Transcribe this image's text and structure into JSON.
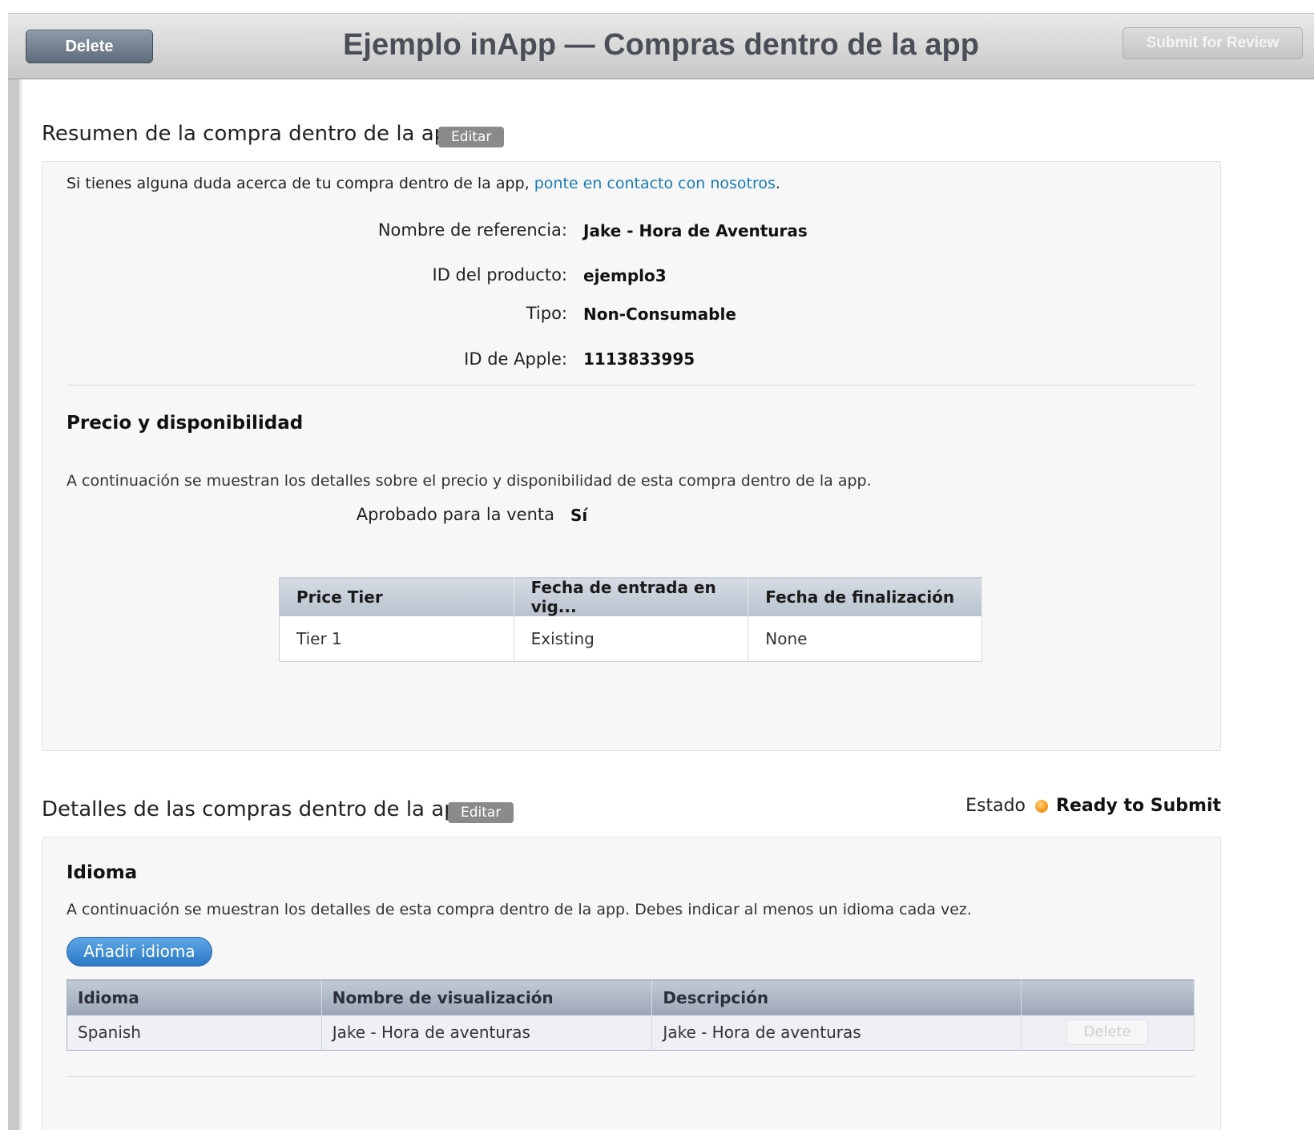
{
  "toolbar": {
    "title": "Ejemplo inApp — Compras dentro de la app",
    "delete_label": "Delete",
    "submit_label": "Submit for Review"
  },
  "summary": {
    "title": "Resumen de la compra dentro de la app",
    "edit_label": "Editar",
    "contact_prefix": "Si tienes alguna duda acerca de tu compra dentro de la app, ",
    "contact_link": "ponte en contacto con nosotros",
    "contact_suffix": ".",
    "fields": [
      {
        "label": "Nombre de referencia:",
        "value": "Jake - Hora de Aventuras"
      },
      {
        "label": "ID del producto:",
        "value": "ejemplo3"
      },
      {
        "label": "Tipo:",
        "value": "Non-Consumable"
      },
      {
        "label": "ID de Apple:",
        "value": "1113833995"
      }
    ]
  },
  "pricing": {
    "title": "Precio y disponibilidad",
    "description": "A continuación se muestran los detalles sobre el precio y disponibilidad de esta compra dentro de la app.",
    "approved_label": "Aprobado para la venta",
    "approved_value": "Sí",
    "table": {
      "headers": [
        "Price Tier",
        "Fecha de entrada en vig...",
        "Fecha de finalización"
      ],
      "rows": [
        [
          "Tier 1",
          "Existing",
          "None"
        ]
      ]
    }
  },
  "details": {
    "title": "Detalles de las compras dentro de la app",
    "edit_label": "Editar",
    "status_label": "Estado",
    "status_value": "Ready to Submit",
    "status_color": "#f29a1a"
  },
  "language": {
    "title": "Idioma",
    "description": "A continuación se muestran los detalles de esta compra dentro de la app. Debes indicar al menos un idioma cada vez.",
    "add_label": "Añadir idioma",
    "table": {
      "headers": [
        "Idioma",
        "Nombre de visualización",
        "Descripción",
        ""
      ],
      "rows": [
        [
          "Spanish",
          "Jake - Hora de aventuras",
          "Jake - Hora de aventuras"
        ]
      ],
      "row_delete_label": "Delete"
    }
  }
}
